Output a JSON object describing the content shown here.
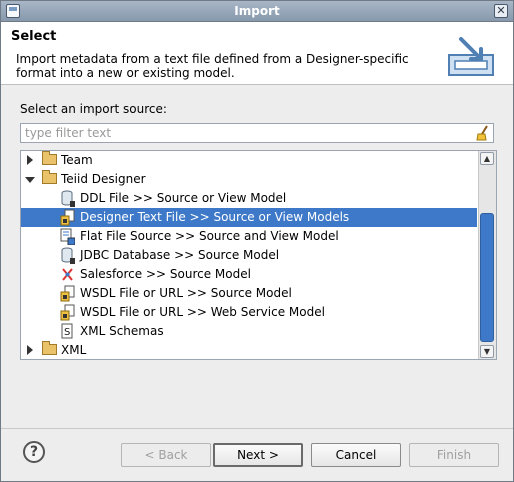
{
  "window": {
    "title": "Import"
  },
  "header": {
    "title": "Select",
    "description": "Import metadata from a text file defined from a Designer-specific format into a new or existing model."
  },
  "source_label": "Select an import source:",
  "filter": {
    "placeholder": "type filter text"
  },
  "tree": {
    "items": [
      {
        "label": "Team",
        "level": 0,
        "expanded": false,
        "icon": "folder-icon"
      },
      {
        "label": "Teiid Designer",
        "level": 0,
        "expanded": true,
        "icon": "folder-icon"
      },
      {
        "label": "DDL File >> Source or View Model",
        "level": 1,
        "icon": "ddl-file-icon"
      },
      {
        "label": "Designer Text File >> Source or View Models",
        "level": 1,
        "icon": "text-file-import-icon",
        "selected": true
      },
      {
        "label": "Flat File Source >> Source and View Model",
        "level": 1,
        "icon": "flat-file-icon"
      },
      {
        "label": "JDBC Database >> Source Model",
        "level": 1,
        "icon": "jdbc-database-icon"
      },
      {
        "label": "Salesforce >> Source Model",
        "level": 1,
        "icon": "salesforce-icon"
      },
      {
        "label": "WSDL File or URL >> Source Model",
        "level": 1,
        "icon": "wsdl-icon"
      },
      {
        "label": "WSDL File or URL >> Web Service Model",
        "level": 1,
        "icon": "wsdl-icon"
      },
      {
        "label": "XML Schemas",
        "level": 1,
        "icon": "xml-schema-icon"
      },
      {
        "label": "XML",
        "level": 0,
        "expanded": false,
        "icon": "folder-icon"
      }
    ]
  },
  "buttons": {
    "back": "< Back",
    "next": "Next >",
    "cancel": "Cancel",
    "finish": "Finish"
  },
  "colors": {
    "selection": "#3d79c8",
    "titlebar": "#8799ad"
  }
}
